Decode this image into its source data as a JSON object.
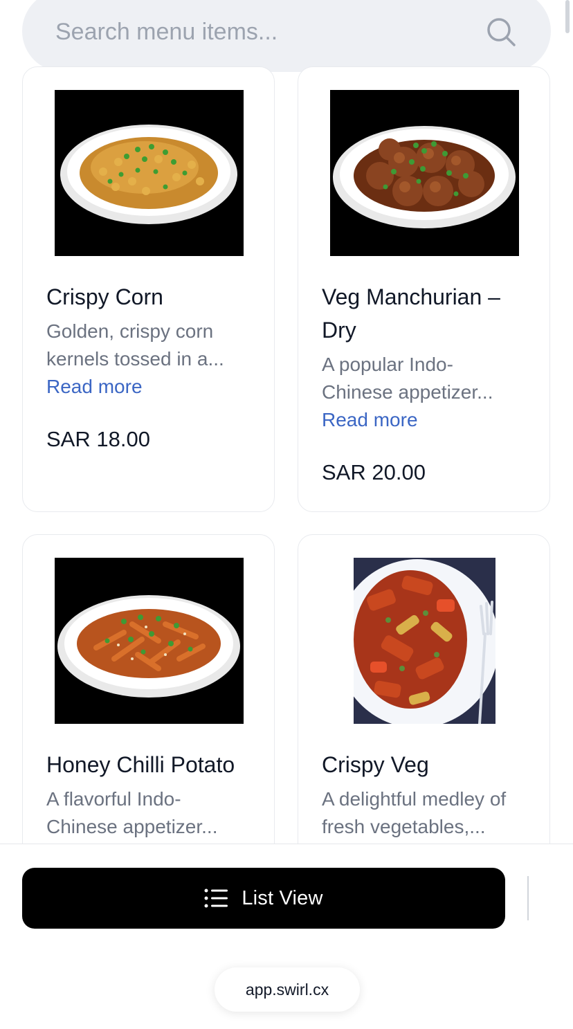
{
  "search": {
    "placeholder": "Search menu items...",
    "value": ""
  },
  "menu": {
    "items": [
      {
        "name": "Crispy Corn",
        "description_line1": "Golden, crispy corn",
        "description_line2": "kernels tossed in a...",
        "read_more": "Read more",
        "price": "SAR 18.00"
      },
      {
        "name_line1": "Veg Manchurian –",
        "name_line2": "Dry",
        "description_line1": "A popular Indo-",
        "description_line2": "Chinese appetizer...",
        "read_more": "Read more",
        "price": "SAR 20.00"
      },
      {
        "name": "Honey Chilli Potato",
        "description_line1": "A flavorful Indo-",
        "description_line2": "Chinese appetizer..."
      },
      {
        "name": "Crispy Veg",
        "description_line1": "A delightful medley of",
        "description_line2": "fresh vegetables,..."
      }
    ]
  },
  "bottom_bar": {
    "view_toggle_label": "List View",
    "view_toggle_icon": "list-icon"
  },
  "browser": {
    "url": "app.swirl.cx"
  },
  "colors": {
    "link": "#3b66c4",
    "button_bg": "#000000",
    "search_bg": "#eef0f4"
  }
}
